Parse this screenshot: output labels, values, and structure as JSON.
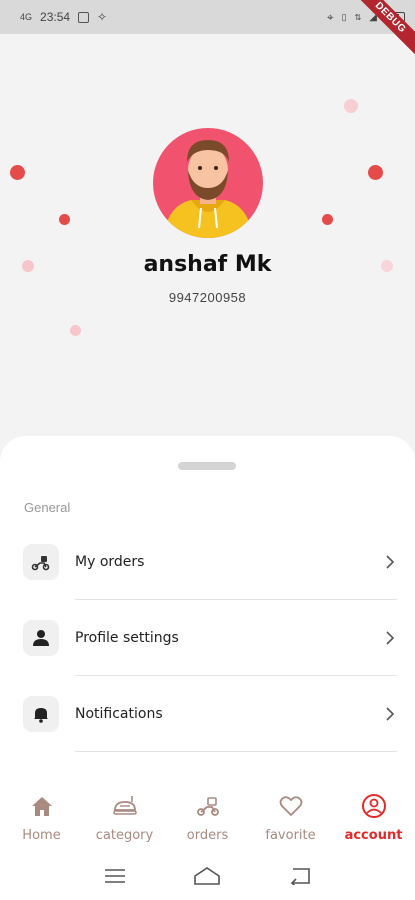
{
  "status_bar": {
    "signal": "4G",
    "time": "23:54",
    "right_icons": [
      "location-icon",
      "vibrate-icon",
      "data-icon",
      "wifi-icon",
      "battery-icon"
    ]
  },
  "debug_banner": "DEBUG",
  "profile": {
    "name": "anshaf Mk",
    "phone": "9947200958"
  },
  "section": {
    "label": "General"
  },
  "menu": [
    {
      "label": "My orders",
      "icon": "scooter-icon"
    },
    {
      "label": "Profile settings",
      "icon": "person-icon"
    },
    {
      "label": "Notifications",
      "icon": "bell-icon"
    }
  ],
  "bottom_nav": [
    {
      "label": "Home",
      "icon": "home-icon",
      "active": false
    },
    {
      "label": "category",
      "icon": "food-icon",
      "active": false
    },
    {
      "label": "orders",
      "icon": "scooter-icon",
      "active": false
    },
    {
      "label": "favorite",
      "icon": "heart-icon",
      "active": false
    },
    {
      "label": "account",
      "icon": "account-icon",
      "active": true
    }
  ],
  "colors": {
    "accent": "#e32a2a",
    "inactive": "#a88a80",
    "avatar_bg": "#f1536e"
  }
}
